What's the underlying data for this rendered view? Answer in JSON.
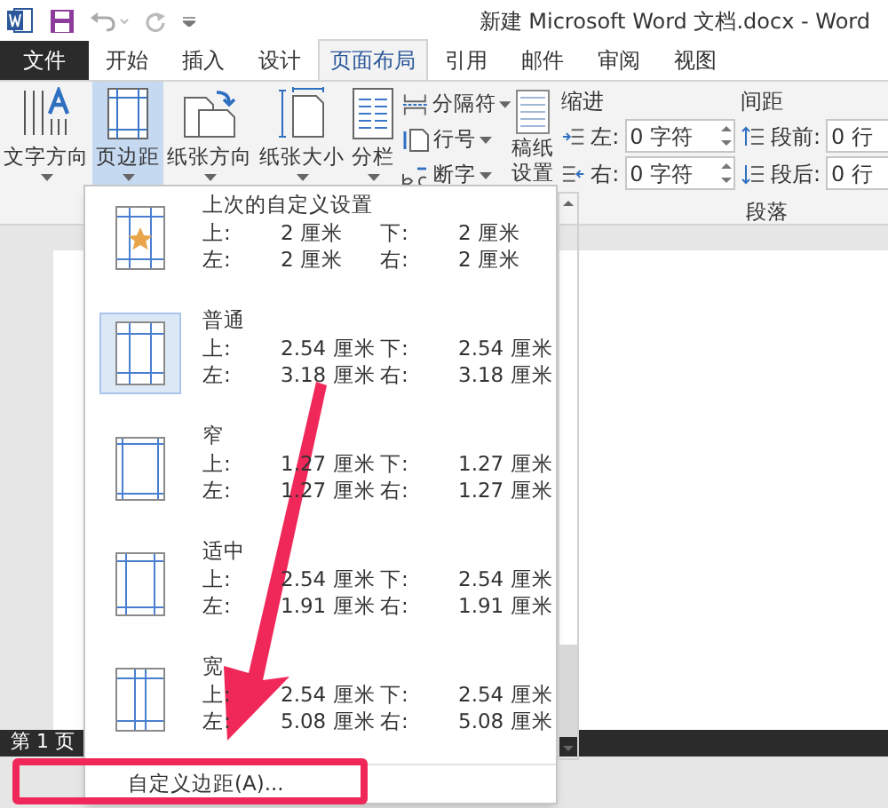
{
  "window": {
    "title": "新建 Microsoft Word 文档.docx - Word"
  },
  "tabs": [
    {
      "label": "文件",
      "kind": "file",
      "selected": false
    },
    {
      "label": "开始",
      "kind": "tab",
      "selected": false
    },
    {
      "label": "插入",
      "kind": "tab",
      "selected": false
    },
    {
      "label": "设计",
      "kind": "tab",
      "selected": false
    },
    {
      "label": "页面布局",
      "kind": "tab",
      "selected": true
    },
    {
      "label": "引用",
      "kind": "tab",
      "selected": false
    },
    {
      "label": "邮件",
      "kind": "tab",
      "selected": false
    },
    {
      "label": "审阅",
      "kind": "tab",
      "selected": false
    },
    {
      "label": "视图",
      "kind": "tab",
      "selected": false
    }
  ],
  "ribbon": {
    "large_buttons": [
      {
        "label": "文字方向",
        "kind": "text-direction",
        "selected": false
      },
      {
        "label": "页边距",
        "kind": "margins",
        "selected": true
      },
      {
        "label": "纸张方向",
        "kind": "orientation",
        "selected": false
      },
      {
        "label": "纸张大小",
        "kind": "size",
        "selected": false
      },
      {
        "label": "分栏",
        "kind": "columns",
        "selected": false
      }
    ],
    "small_buttons": [
      {
        "label": "分隔符",
        "kind": "breaks"
      },
      {
        "label": "行号",
        "kind": "line-numbers"
      },
      {
        "label": "断字",
        "kind": "hyphenation"
      }
    ],
    "setup_button": [
      "稿纸",
      "设置"
    ],
    "indent": {
      "title": "缩进",
      "rows": [
        {
          "label": "左:",
          "value": "0 字符",
          "kind": "left"
        },
        {
          "label": "右:",
          "value": "0 字符",
          "kind": "right"
        }
      ]
    },
    "spacing": {
      "title": "间距",
      "rows": [
        {
          "label": "段前:",
          "value": "0 行",
          "kind": "before"
        },
        {
          "label": "段后:",
          "value": "0 行",
          "kind": "after"
        }
      ]
    },
    "group_label": "段落"
  },
  "margins_menu": {
    "items": [
      {
        "name": "上次的自定义设置",
        "kind": "custom",
        "selected": false,
        "values": [
          [
            "上:",
            "2 厘米",
            "下:",
            "2 厘米"
          ],
          [
            "左:",
            "2 厘米",
            "右:",
            "2 厘米"
          ]
        ]
      },
      {
        "name": "普通",
        "kind": "normal",
        "selected": true,
        "values": [
          [
            "上:",
            "2.54 厘米",
            "下:",
            "2.54 厘米"
          ],
          [
            "左:",
            "3.18 厘米",
            "右:",
            "3.18 厘米"
          ]
        ]
      },
      {
        "name": "窄",
        "kind": "narrow",
        "selected": false,
        "values": [
          [
            "上:",
            "1.27 厘米",
            "下:",
            "1.27 厘米"
          ],
          [
            "左:",
            "1.27 厘米",
            "右:",
            "1.27 厘米"
          ]
        ]
      },
      {
        "name": "适中",
        "kind": "moderate",
        "selected": false,
        "values": [
          [
            "上:",
            "2.54 厘米",
            "下:",
            "2.54 厘米"
          ],
          [
            "左:",
            "1.91 厘米",
            "右:",
            "1.91 厘米"
          ]
        ]
      },
      {
        "name": "宽",
        "kind": "wide",
        "selected": false,
        "values": [
          [
            "上:",
            "2.54 厘米",
            "下:",
            "2.54 厘米"
          ],
          [
            "左:",
            "5.08 厘米",
            "右:",
            "5.08 厘米"
          ]
        ]
      }
    ],
    "footer": "自定义边距(A)..."
  },
  "status_bar": {
    "page": "第 1 页"
  }
}
